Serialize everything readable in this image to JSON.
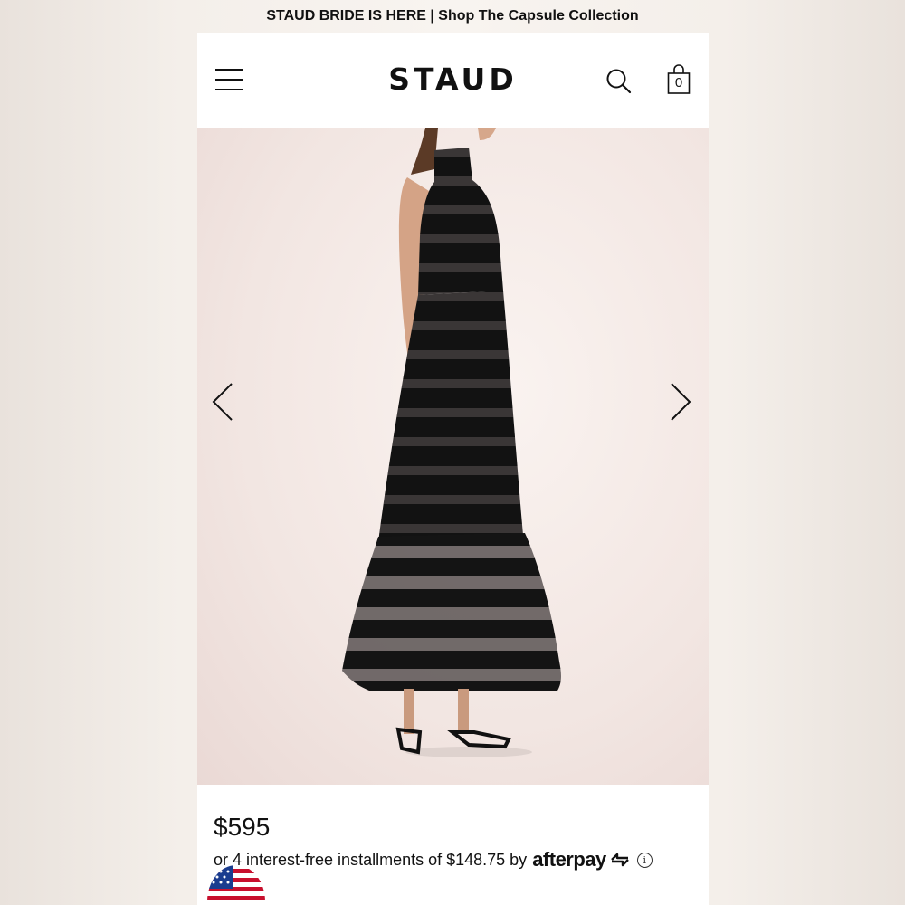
{
  "promo_banner": {
    "text": "STAUD BRIDE IS HERE | Shop The Capsule Collection"
  },
  "header": {
    "logo": "STAUD",
    "menu_icon": "hamburger-menu-icon",
    "search_icon": "search-icon",
    "bag_icon": "shopping-bag-icon",
    "bag_count": "0"
  },
  "gallery": {
    "image": "black-tiered-organza-maxi-dress-photo",
    "prev_icon": "chevron-left-icon",
    "next_icon": "chevron-right-icon"
  },
  "product": {
    "price": "$595",
    "installments_text": "or 4 interest-free installments of $148.75 by",
    "afterpay_logo": "afterpay",
    "info_icon": "info-icon"
  },
  "locale": {
    "flag_icon": "us-flag-icon"
  },
  "colors": {
    "text": "#111111",
    "panel": "#ffffff",
    "dress": "#141414",
    "background": "#f4efea"
  }
}
